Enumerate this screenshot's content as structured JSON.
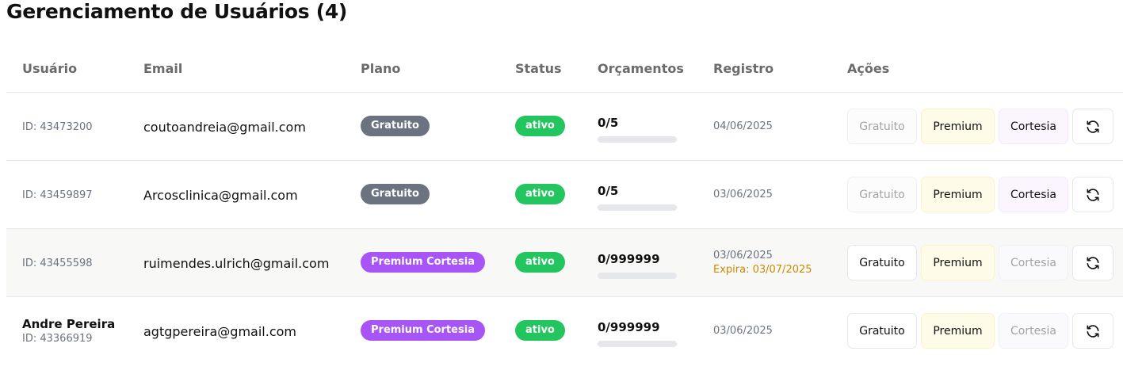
{
  "page": {
    "title": "Gerenciamento de Usuários (4)"
  },
  "table": {
    "headers": {
      "user": "Usuário",
      "email": "Email",
      "plan": "Plano",
      "status": "Status",
      "budgets": "Orçamentos",
      "registration": "Registro",
      "actions": "Ações"
    },
    "rows": [
      {
        "name": "",
        "id": "ID: 43473200",
        "email": "coutoandreia@gmail.com",
        "plan": "Gratuito",
        "status": "ativo",
        "budgets": "0/5",
        "budgets_used_fraction": 0,
        "registered": "04/06/2025",
        "expires": "",
        "actions": {
          "gratuito": "Gratuito",
          "premium": "Premium",
          "cortesia": "Cortesia"
        }
      },
      {
        "name": "",
        "id": "ID: 43459897",
        "email": "Arcosclinica@gmail.com",
        "plan": "Gratuito",
        "status": "ativo",
        "budgets": "0/5",
        "budgets_used_fraction": 0,
        "registered": "03/06/2025",
        "expires": "",
        "actions": {
          "gratuito": "Gratuito",
          "premium": "Premium",
          "cortesia": "Cortesia"
        }
      },
      {
        "name": "",
        "id": "ID: 43455598",
        "email": "ruimendes.ulrich@gmail.com",
        "plan": "Premium Cortesia",
        "status": "ativo",
        "budgets": "0/999999",
        "budgets_used_fraction": 0,
        "registered": "03/06/2025",
        "expires": "Expira: 03/07/2025",
        "actions": {
          "gratuito": "Gratuito",
          "premium": "Premium",
          "cortesia": "Cortesia"
        }
      },
      {
        "name": "Andre Pereira",
        "id": "ID: 43366919",
        "email": "agtgpereira@gmail.com",
        "plan": "Premium Cortesia",
        "status": "ativo",
        "budgets": "0/999999",
        "budgets_used_fraction": 0,
        "registered": "03/06/2025",
        "expires": "",
        "actions": {
          "gratuito": "Gratuito",
          "premium": "Premium",
          "cortesia": "Cortesia"
        }
      }
    ]
  },
  "icons": {
    "refresh": "refresh-icon"
  },
  "colors": {
    "plan_gratuito": "#6b7280",
    "plan_cortesia": "#a855f7",
    "status_active": "#22c55e",
    "premium_button_bg": "#fefce8",
    "cortesia_button_bg": "#faf5ff",
    "expire_text": "#ca8a04"
  }
}
